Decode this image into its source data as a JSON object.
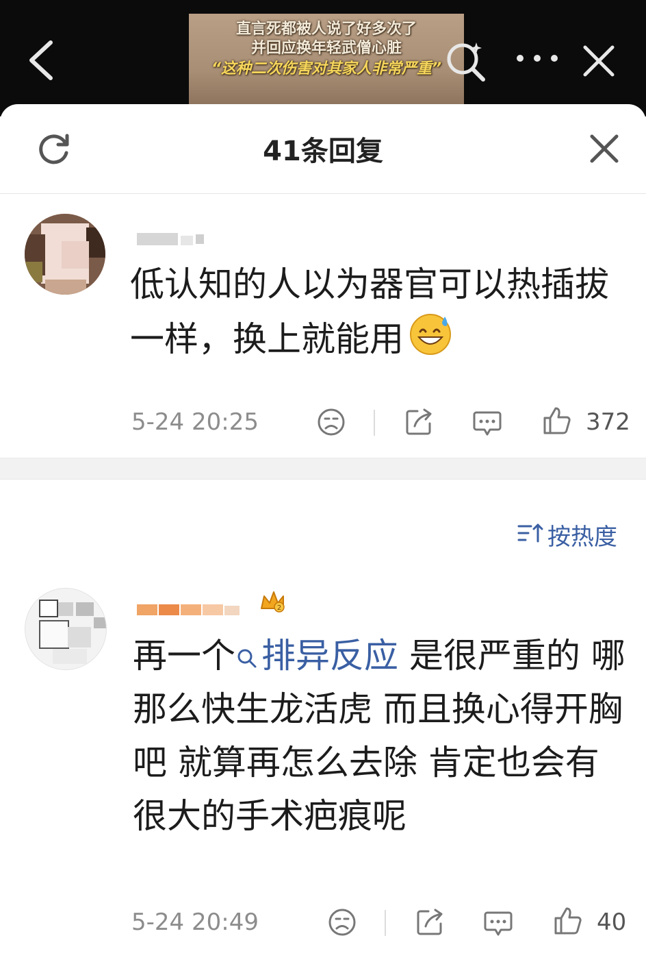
{
  "video": {
    "caption_line1": "直言死都被人说了好多次了",
    "caption_line2": "并回应换年轻武僧心脏",
    "caption_line3": "“这种二次伤害对其家人非常严重”"
  },
  "topbar_icons": [
    "back-icon",
    "lens-search-icon",
    "more-icon",
    "close-icon"
  ],
  "sheet": {
    "title": "41条回复"
  },
  "comments": [
    {
      "username_visible": "",
      "text": "低认知的人以为器官可以热插拔一样，换上就能用",
      "emoji": "grinning-sweat-emoji",
      "time": "5-24 20:25",
      "likes": "372"
    },
    {
      "username_visible": "",
      "text_before_topic": "再一个",
      "topic": "排异反应",
      "text_after_topic": " 是很严重的 哪那么快生龙活虎 而且换心得开胸吧 就算再怎么去除 肯定也会有很大的手术疤痕呢",
      "time": "5-24 20:49",
      "likes": "40"
    }
  ],
  "sort": {
    "label": "按热度"
  },
  "colors": {
    "link_blue": "#3a5fa3",
    "meta_gray": "#8c8c8c",
    "separator": "#f2f2f2"
  }
}
